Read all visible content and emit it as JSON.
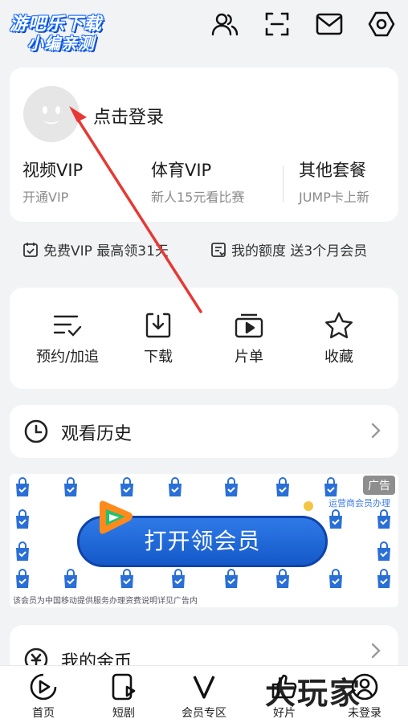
{
  "watermark_logo": {
    "line1": "游吧乐下载",
    "line2": "小编亲测"
  },
  "top_icons": [
    "friends-icon",
    "scan-icon",
    "mail-icon",
    "settings-icon"
  ],
  "login": {
    "prompt": "点击登录"
  },
  "vip_options": [
    {
      "title": "视频VIP",
      "subtitle": "开通VIP"
    },
    {
      "title": "体育VIP",
      "subtitle": "新人15元看比赛"
    },
    {
      "title": "其他套餐",
      "subtitle": "JUMP卡上新"
    }
  ],
  "promos": [
    {
      "icon": "calendar-check-icon",
      "text": "免费VIP 最高领31天"
    },
    {
      "icon": "quota-icon",
      "text": "我的额度 送3个月会员"
    }
  ],
  "actions": [
    {
      "icon": "list-check-icon",
      "label": "预约/加追"
    },
    {
      "icon": "download-icon",
      "label": "下载"
    },
    {
      "icon": "playlist-icon",
      "label": "片单"
    },
    {
      "icon": "star-icon",
      "label": "收藏"
    }
  ],
  "history": {
    "label": "观看历史"
  },
  "ad": {
    "tag": "广告",
    "corner_text": "运营商会员办理",
    "button_label": "打开领会员",
    "disclaimer": "该会员为中国移动提供服务办理资费说明详见广告内"
  },
  "coins": {
    "label": "我的金币"
  },
  "bottom_nav": [
    {
      "icon": "home-play-icon",
      "label": "首页"
    },
    {
      "icon": "short-drama-icon",
      "label": "短剧"
    },
    {
      "icon": "vip-v-icon",
      "label": "会员专区"
    },
    {
      "icon": "good-film-icon",
      "label": "好片"
    },
    {
      "icon": "user-icon",
      "label": "未登录"
    }
  ],
  "watermark_overlay": "大玩家",
  "colors": {
    "accent": "#1a6cff",
    "arrow": "#e53935",
    "ad_button": "#1f66d6"
  }
}
